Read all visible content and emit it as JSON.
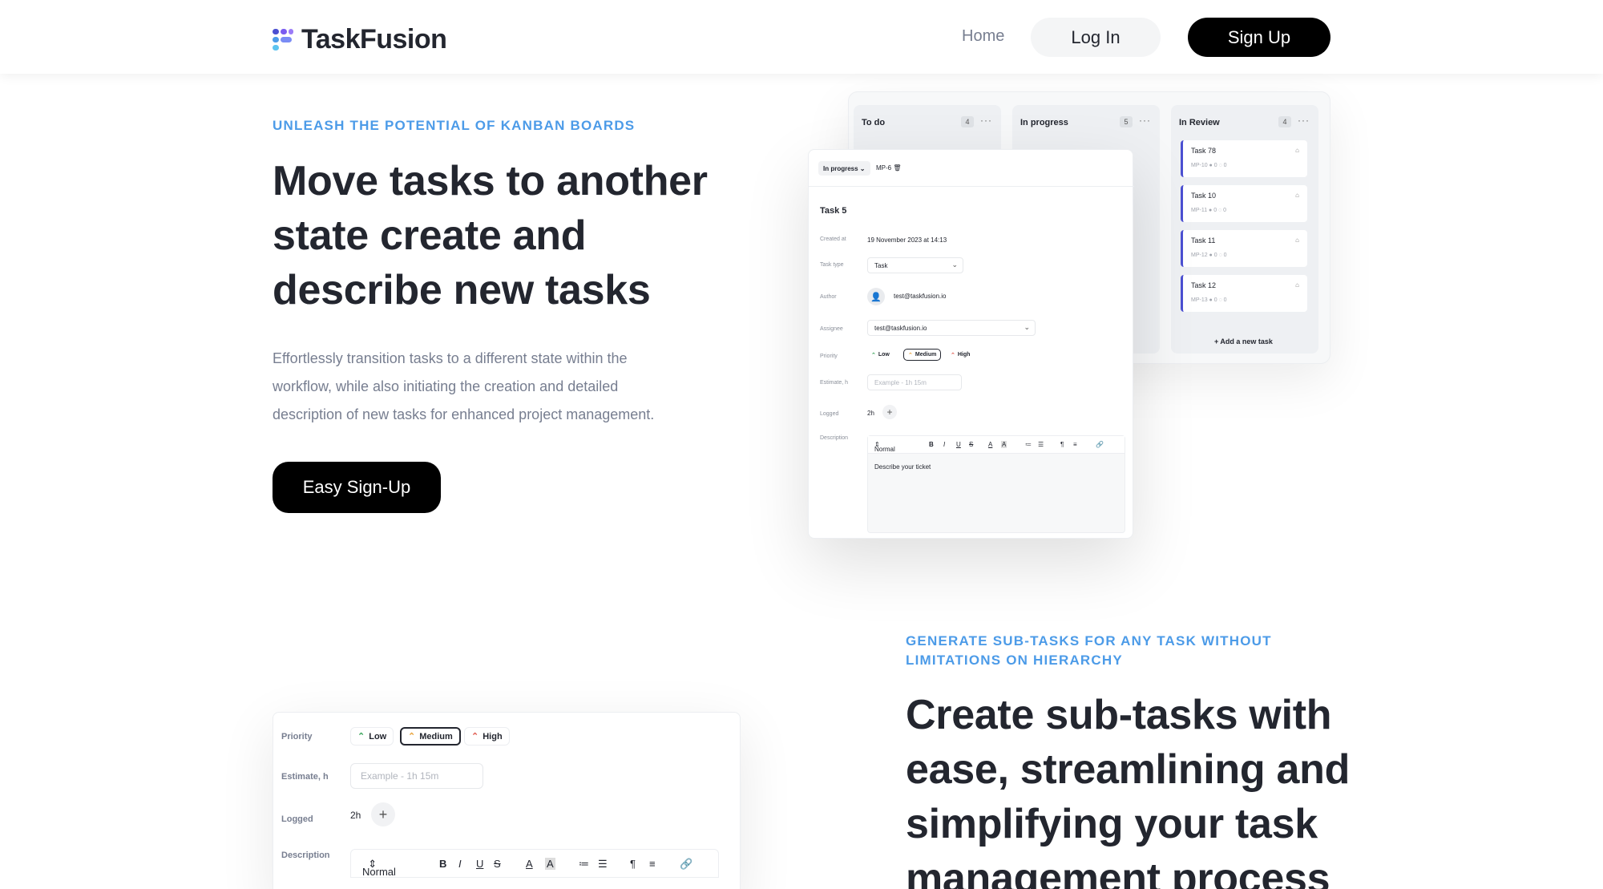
{
  "nav": {
    "logo_text": "TaskFusion",
    "home": "Home",
    "login": "Log In",
    "signup": "Sign Up"
  },
  "section1": {
    "eyebrow": "UNLEASH THE POTENTIAL OF KANBAN BOARDS",
    "headline_lines": [
      "Move tasks to another",
      "state create and",
      "describe new tasks"
    ],
    "description_lines": [
      "Effortlessly transition tasks to a different state within the",
      "workflow, while also initiating the creation and detailed",
      "description of new tasks for enhanced project management."
    ],
    "cta": "Easy Sign-Up"
  },
  "board": {
    "columns": [
      {
        "title": "To do",
        "count": "4"
      },
      {
        "title": "In progress",
        "count": "5"
      },
      {
        "title": "In Review",
        "count": "4"
      }
    ],
    "review_cards": [
      {
        "title": "Task 78",
        "meta": "MP-10 ● 0 ◌ 0"
      },
      {
        "title": "Task 10",
        "meta": "MP-11 ● 0 ◌ 0"
      },
      {
        "title": "Task 11",
        "meta": "MP-12 ● 0 ◌ 0"
      },
      {
        "title": "Task 12",
        "meta": "MP-13 ● 0 ◌ 0"
      }
    ],
    "add_task": "+ Add a new task"
  },
  "modal": {
    "state": "In progress",
    "key": "MP-6",
    "title": "Task 5",
    "created_label": "Created at",
    "created_value": "19 November 2023 at 14:13",
    "type_label": "Task type",
    "type_value": "Task",
    "author_label": "Author",
    "author_value": "test@taskfusion.io",
    "assignee_label": "Assignee",
    "assignee_value": "test@taskfusion.io",
    "priority_label": "Priority",
    "priority_low": "Low",
    "priority_medium": "Medium",
    "priority_high": "High",
    "estimate_label": "Estimate, h",
    "estimate_placeholder": "Example - 1h 15m",
    "logged_label": "Logged",
    "logged_value": "2h",
    "description_label": "Description",
    "toolbar_style": "Normal",
    "description_placeholder": "Describe your ticket"
  },
  "section2": {
    "eyebrow_lines": [
      "GENERATE SUB-TASKS FOR ANY TASK WITHOUT",
      "LIMITATIONS ON HIERARCHY"
    ],
    "headline_lines": [
      "Create sub-tasks with",
      "ease, streamlining and",
      "simplifying your task",
      "management process"
    ],
    "editor": {
      "priority_label": "Priority",
      "low": "Low",
      "medium": "Medium",
      "high": "High",
      "estimate_label": "Estimate, h",
      "estimate_placeholder": "Example - 1h 15m",
      "logged_label": "Logged",
      "logged_value": "2h",
      "description_label": "Description",
      "toolbar_style": "Normal"
    }
  },
  "colors": {
    "accent_blue": "#4c9be8",
    "card_border": "#4b4fd1",
    "low": "#3aa55b",
    "medium": "#e8a23a",
    "high": "#e05a4f"
  }
}
